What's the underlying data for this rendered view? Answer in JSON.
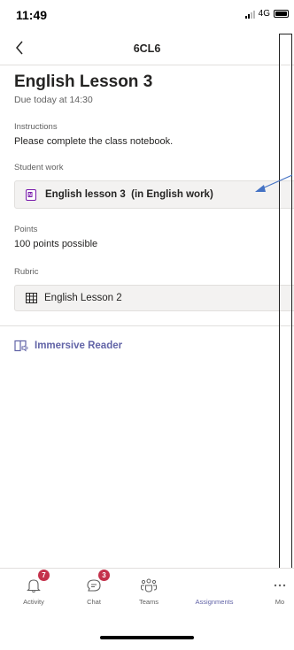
{
  "status_bar": {
    "time": "11:49",
    "network": "4G"
  },
  "nav": {
    "title": "6CL6"
  },
  "assignment": {
    "title": "English Lesson 3",
    "due": "Due today at 14:30",
    "instructions_label": "Instructions",
    "instructions_text": "Please complete the class notebook.",
    "student_work_label": "Student work",
    "student_work_item": "English lesson 3  (in English work)",
    "points_label": "Points",
    "points_text": "100 points possible",
    "rubric_label": "Rubric",
    "rubric_item": "English Lesson 2"
  },
  "immersive_reader": {
    "label": "Immersive Reader"
  },
  "tabs": [
    {
      "label": "Activity",
      "badge": "7",
      "icon": "bell-icon"
    },
    {
      "label": "Chat",
      "badge": "3",
      "icon": "chat-icon"
    },
    {
      "label": "Teams",
      "icon": "teams-icon"
    },
    {
      "label": "Assignments",
      "icon": "assignments-icon",
      "active": true
    },
    {
      "label": "Mo",
      "icon": "more-icon"
    }
  ],
  "colors": {
    "accent": "#6264a7",
    "badge": "#c4314b",
    "annotation_arrow": "#4472c4"
  }
}
